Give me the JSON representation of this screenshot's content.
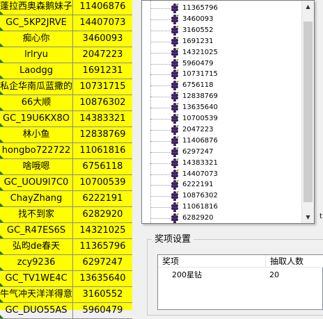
{
  "grid": {
    "rows": [
      {
        "name": "蓬拉西奥森鹅妹子情",
        "id": "11406876"
      },
      {
        "name": "GC_5KP2JRVE",
        "id": "14407073"
      },
      {
        "name": "痴心你",
        "id": "3460093"
      },
      {
        "name": "lrlryu",
        "id": "2047223"
      },
      {
        "name": "Laodgg",
        "id": "1691231"
      },
      {
        "name": "私企华南瓜蓝撒的",
        "id": "10731715"
      },
      {
        "name": "66大顺",
        "id": "10876302"
      },
      {
        "name": "GC_19U6KX8O",
        "id": "14383321"
      },
      {
        "name": "林小鱼",
        "id": "12838769"
      },
      {
        "name": "hongbo722722",
        "id": "11061816"
      },
      {
        "name": "啥哦嗯",
        "id": "6756118"
      },
      {
        "name": "GC_UOU9I7C0",
        "id": "10700539"
      },
      {
        "name": "ChayZhang",
        "id": "6222191"
      },
      {
        "name": "找不到家",
        "id": "6282920"
      },
      {
        "name": "GC_R47ES6S",
        "id": "14321025"
      },
      {
        "name": "弘昀de春天",
        "id": "11365796"
      },
      {
        "name": "zcy9236",
        "id": "6297247"
      },
      {
        "name": "GC_TV1WE4C",
        "id": "13635640"
      },
      {
        "name": "牛气冲天洋洋得意",
        "id": "3160552"
      },
      {
        "name": "GC_DUO55AS",
        "id": "5960479"
      }
    ]
  },
  "popup_list": {
    "items": [
      "11365796",
      "3460093",
      "3160552",
      "1691231",
      "14321025",
      "5960479",
      "10731715",
      "6756118",
      "12838769",
      "13635640",
      "10700539",
      "2047223",
      "11406876",
      "6297247",
      "14383321",
      "14407073",
      "6222191",
      "10876302",
      "11061816",
      "6282920"
    ],
    "scroll_up_glyph": "▲",
    "scroll_down_glyph": "▼",
    "item_icon": "grape-cluster-icon"
  },
  "award_settings": {
    "title": "奖项设置",
    "columns": [
      "奖项",
      "抽取人数"
    ],
    "rows": [
      {
        "prize": "200星钻",
        "count": "20"
      }
    ]
  },
  "edge_fragment": "t"
}
